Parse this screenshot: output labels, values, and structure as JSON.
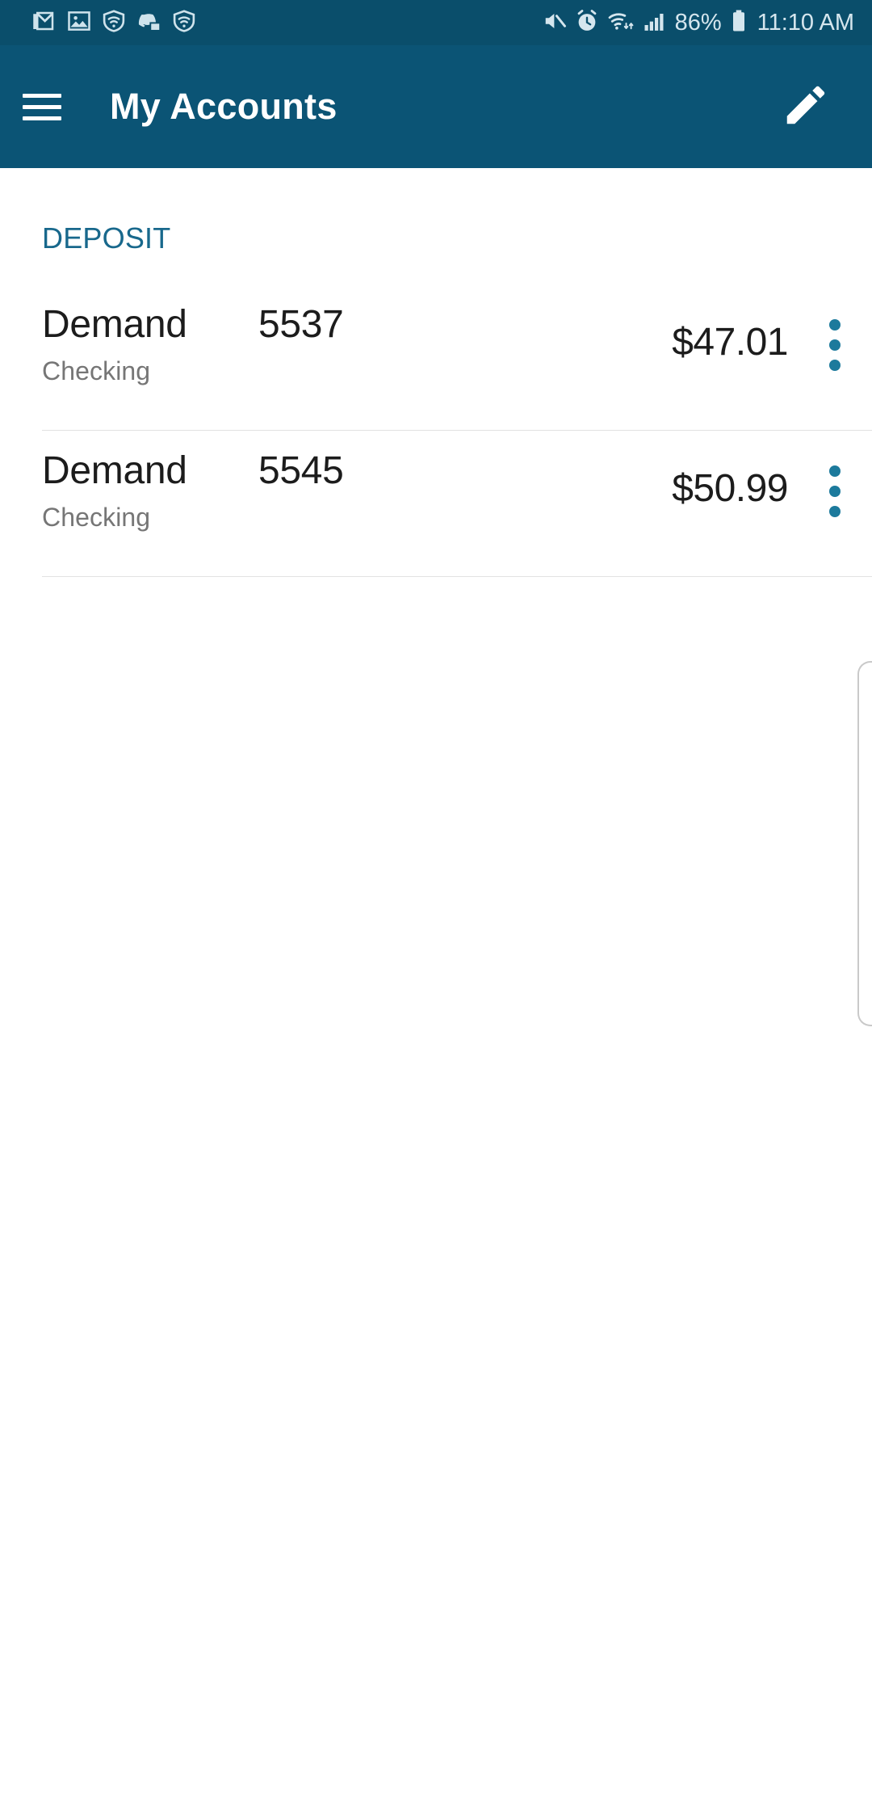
{
  "status_bar": {
    "left_icons": [
      {
        "name": "gmail-icon",
        "label": "Gmail"
      },
      {
        "name": "image-icon",
        "label": "Screenshot"
      },
      {
        "name": "shield-wifi-icon",
        "label": "VPN shield"
      },
      {
        "name": "discord-icon",
        "label": "Discord"
      },
      {
        "name": "shield-wifi-icon-2",
        "label": "VPN shield"
      }
    ],
    "right_icons": [
      {
        "name": "mute-icon",
        "label": "Sound off"
      },
      {
        "name": "alarm-icon",
        "label": "Alarm set"
      },
      {
        "name": "wifi-icon",
        "label": "Wi-Fi"
      },
      {
        "name": "signal-icon",
        "label": "Cellular signal"
      }
    ],
    "battery_percent": "86%",
    "clock": "11:10 AM",
    "background_color": "#0a4e6b",
    "foreground_color": "#d5e6ee"
  },
  "app_bar": {
    "menu_icon": "hamburger-menu-icon",
    "title": "My Accounts",
    "action_icon": "edit-pencil-icon",
    "background_color": "#0b5475",
    "title_color": "#ffffff"
  },
  "main": {
    "sections": [
      {
        "header": "DEPOSIT",
        "header_color": "#18688c",
        "accounts": [
          {
            "name": "Demand",
            "number": "5537",
            "subtype": "Checking",
            "balance": "$47.01",
            "overflow_icon": "more-vertical-icon"
          },
          {
            "name": "Demand",
            "number": "5545",
            "subtype": "Checking",
            "balance": "$50.99",
            "overflow_icon": "more-vertical-icon"
          }
        ]
      }
    ],
    "accent_color": "#1c7a9c",
    "divider_color": "#e2e2e2",
    "background_color": "#ffffff"
  }
}
